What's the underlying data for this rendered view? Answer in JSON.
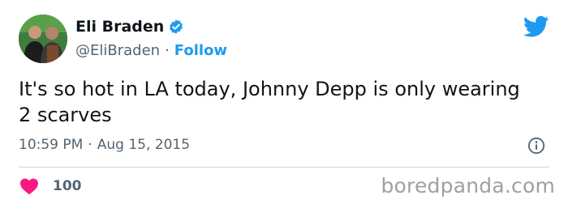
{
  "tweet": {
    "author": {
      "display_name": "Eli Braden",
      "handle": "@EliBraden",
      "separator": "·",
      "follow_label": "Follow",
      "verified": true
    },
    "text": "It's so hot in LA today, Johnny Depp is only wearing 2 scarves",
    "time": "10:59 PM",
    "time_separator": "·",
    "date": "Aug 15, 2015",
    "likes": "100"
  },
  "icons": {
    "verified": "verified-badge-icon",
    "logo": "twitter-bird-icon",
    "info": "info-icon",
    "like": "heart-icon"
  },
  "colors": {
    "accent": "#1d9bf0",
    "like": "#f91880",
    "text": "#0f1419",
    "muted": "#536471",
    "watermark": "#a0a0a0"
  },
  "watermark": "boredpanda.com"
}
